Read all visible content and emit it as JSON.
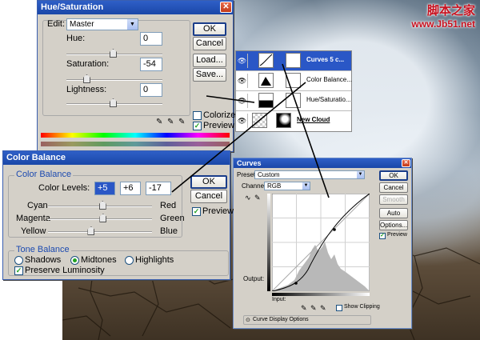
{
  "watermark": {
    "line1": "脚本之家",
    "line2": "www.Jb51.net"
  },
  "hue_sat": {
    "title": "Hue/Saturation",
    "edit_label": "Edit:",
    "edit_value": "Master",
    "hue_label": "Hue:",
    "hue_value": "0",
    "saturation_label": "Saturation:",
    "saturation_value": "-54",
    "lightness_label": "Lightness:",
    "lightness_value": "0",
    "ok": "OK",
    "cancel": "Cancel",
    "load": "Load...",
    "save": "Save...",
    "colorize": "Colorize",
    "preview": "Preview"
  },
  "color_balance": {
    "title": "Color Balance",
    "group_title": "Color Balance",
    "levels_label": "Color Levels:",
    "level1": "+5",
    "level2": "+6",
    "level3": "-17",
    "cyan": "Cyan",
    "red": "Red",
    "magenta": "Magenta",
    "green": "Green",
    "yellow": "Yellow",
    "blue": "Blue",
    "tone_title": "Tone Balance",
    "shadows": "Shadows",
    "midtones": "Midtones",
    "highlights": "Highlights",
    "preserve": "Preserve Luminosity",
    "ok": "OK",
    "cancel": "Cancel",
    "preview": "Preview",
    "sliders": {
      "cyan_red": 0.05,
      "magenta_green": 0.06,
      "yellow_blue": -0.17
    }
  },
  "layers": {
    "items": [
      {
        "name": "Curves 5 c...",
        "selected": true
      },
      {
        "name": "Color Balance...",
        "selected": false
      },
      {
        "name": "Hue/Saturatio...",
        "selected": false
      },
      {
        "name": "New Cloud",
        "selected": false
      }
    ]
  },
  "curves": {
    "title": "Curves",
    "preset_label": "Preset:",
    "preset_value": "Custom",
    "channel_label": "Channel:",
    "channel_value": "RGB",
    "output_label": "Output:",
    "input_label": "Input:",
    "show_clipping": "Show Clipping",
    "display_options": "Curve Display Options",
    "ok": "OK",
    "cancel": "Cancel",
    "smooth": "Smooth",
    "auto": "Auto",
    "options": "Options...",
    "preview": "Preview"
  }
}
